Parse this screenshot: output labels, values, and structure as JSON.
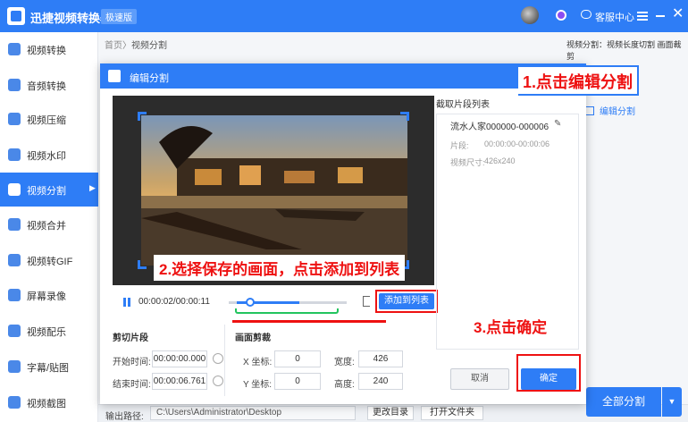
{
  "titlebar": {
    "app_title": "迅捷视频转换器",
    "edition": "极速版",
    "service": "客服中心",
    "close_glyph": "✕"
  },
  "sidebar": {
    "items": [
      {
        "label": "视频转换"
      },
      {
        "label": "音频转换"
      },
      {
        "label": "视频压缩"
      },
      {
        "label": "视频水印"
      },
      {
        "label": "视频分割",
        "active": true
      },
      {
        "label": "视频合并"
      },
      {
        "label": "视频转GIF"
      },
      {
        "label": "屏幕录像"
      },
      {
        "label": "视频配乐"
      },
      {
        "label": "字幕/贴图"
      },
      {
        "label": "视频截图"
      }
    ]
  },
  "breadcrumb": {
    "home": "首页",
    "sep": "〉",
    "current": "视频分割"
  },
  "top_hint": "视频分割：视频长度切割 画面裁剪",
  "background": {
    "edit_link": "编辑分割"
  },
  "bottom": {
    "output_label": "输出路径:",
    "output_path": "C:\\Users\\Administrator\\Desktop",
    "change_dir": "更改目录",
    "open_folder": "打开文件夹",
    "split_all": "全部分割",
    "split_drop": "▼"
  },
  "dialog": {
    "title": "编辑分割",
    "player": {
      "timecode": "00:00:02/00:00:11",
      "add_to_list": "添加到列表",
      "position_fraction": 0.18
    },
    "trim": {
      "title": "剪切片段",
      "start_label": "开始时间:",
      "start_value": "00:00:00.000",
      "end_label": "结束时间:",
      "end_value": "00:00:06.761"
    },
    "crop": {
      "title": "画面剪裁",
      "x_label": "X 坐标:",
      "x_value": "0",
      "y_label": "Y 坐标:",
      "y_value": "0",
      "w_label": "宽度:",
      "w_value": "426",
      "h_label": "高度:",
      "h_value": "240"
    },
    "list": {
      "title": "截取片段列表",
      "clip_name": "流水人家000000-000006",
      "clip_edit_glyph": "✎",
      "segment_label": "片段:",
      "segment_value": "00:00:00-00:00:06",
      "size_label": "视频尺寸:",
      "size_value": "426x240"
    },
    "cancel": "取消",
    "ok": "确定"
  },
  "annotations": {
    "step1": "1.点击编辑分割",
    "step2": "2.选择保存的画面，点击添加到列表",
    "step3": "3.点击确定"
  },
  "colors": {
    "accent": "#2e7df6",
    "annotation": "#ee1111",
    "range": "#22c45e"
  }
}
